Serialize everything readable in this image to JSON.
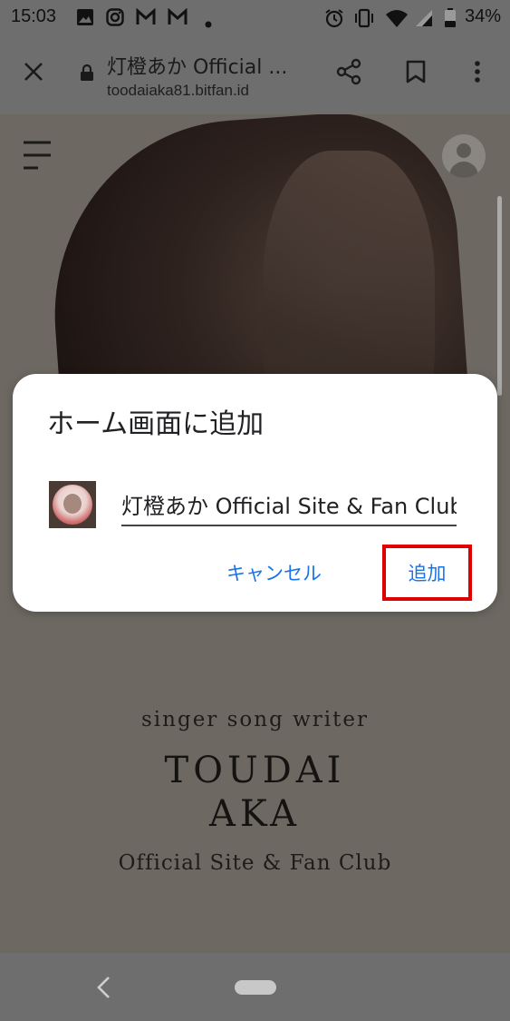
{
  "statusbar": {
    "time": "15:03",
    "notification_icons": [
      "image-icon",
      "instagram-icon",
      "gmail-icon",
      "gmail-icon",
      "dot-icon"
    ],
    "system_icons": [
      "alarm-icon",
      "vibrate-icon",
      "wifi-icon",
      "signal-icon",
      "battery-icon"
    ],
    "battery": "34%"
  },
  "toolbar": {
    "title": "灯橙あか Official ...",
    "url": "toodaiaka81.bitfan.id",
    "icons": [
      "close-icon",
      "lock-icon",
      "share-icon",
      "bookmark-icon",
      "more-icon"
    ]
  },
  "page": {
    "tagline": "singer song writer",
    "title_line1": "TOUDAI",
    "title_line2": "AKA",
    "subtitle": "Official Site & Fan Club"
  },
  "dialog": {
    "title": "ホーム画面に追加",
    "input_value": "灯橙あか Official Site & Fan Club",
    "cancel_label": "キャンセル",
    "add_label": "追加",
    "accent_color": "#1a73e8",
    "highlight_color": "#e00000"
  },
  "navbar": {
    "icons": [
      "back-icon",
      "home-pill-icon"
    ]
  }
}
